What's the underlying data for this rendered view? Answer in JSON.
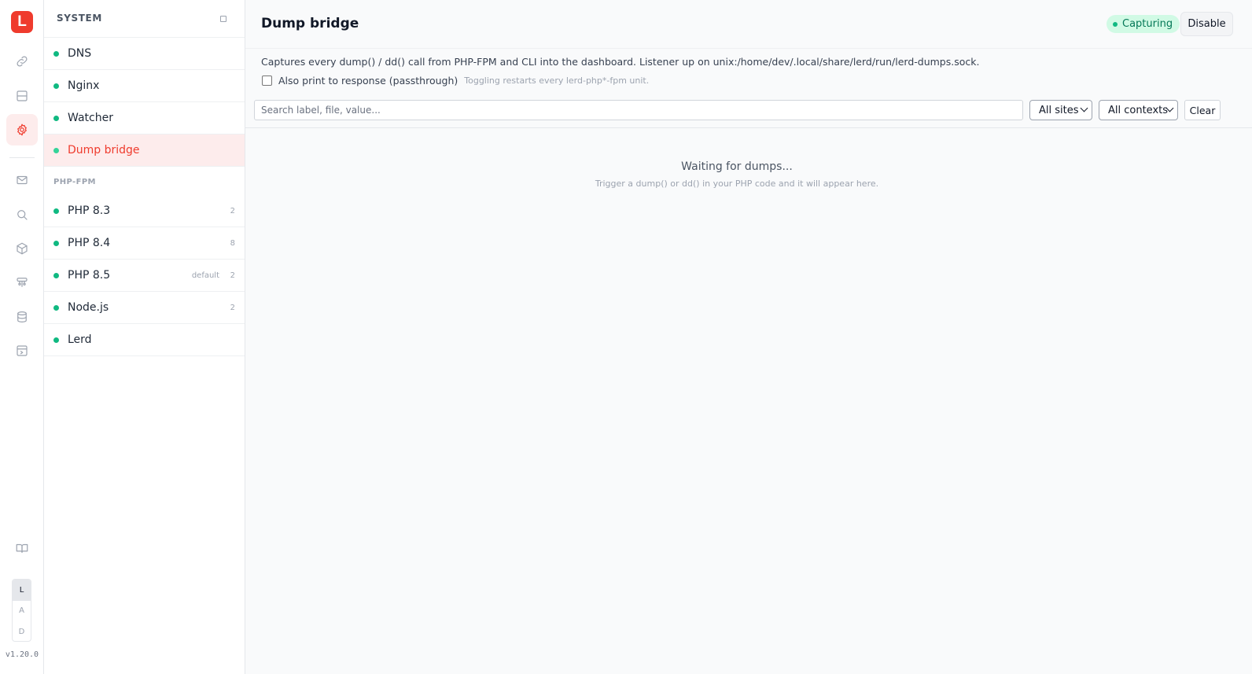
{
  "rail": {
    "logo_letter": "L",
    "items": [
      {
        "icon": "link-icon"
      },
      {
        "icon": "server-icon"
      },
      {
        "icon": "gear-icon",
        "active": true
      },
      {
        "icon": "mail-icon"
      },
      {
        "icon": "search-icon"
      },
      {
        "icon": "box-icon"
      },
      {
        "icon": "network-icon"
      },
      {
        "icon": "database-icon"
      },
      {
        "icon": "terminal-icon"
      },
      {
        "icon": "book-icon"
      }
    ],
    "theme_options": [
      "L",
      "A",
      "D"
    ],
    "theme_selected": "L",
    "version": "v1.20.0"
  },
  "sidebar": {
    "title": "SYSTEM",
    "system_items": [
      {
        "label": "DNS"
      },
      {
        "label": "Nginx"
      },
      {
        "label": "Watcher"
      },
      {
        "label": "Dump bridge",
        "active": true
      }
    ],
    "section_label": "PHP-FPM",
    "php_items": [
      {
        "label": "PHP 8.3",
        "count": "2"
      },
      {
        "label": "PHP 8.4",
        "count": "8"
      },
      {
        "label": "PHP 8.5",
        "tag": "default",
        "count": "2"
      },
      {
        "label": "Node.js",
        "count": "2"
      },
      {
        "label": "Lerd"
      }
    ]
  },
  "main": {
    "title": "Dump bridge",
    "status": "Capturing",
    "disable_label": "Disable",
    "description": "Captures every dump() / dd() call from PHP-FPM and CLI into the dashboard. Listener up on unix:/home/dev/.local/share/lerd/run/lerd-dumps.sock.",
    "passthrough_label": "Also print to response (passthrough)",
    "passthrough_hint": "Toggling restarts every lerd-php*-fpm unit.",
    "search_placeholder": "Search label, file, value...",
    "sites_filter": "All sites",
    "contexts_filter": "All contexts",
    "clear_label": "Clear",
    "empty_title": "Waiting for dumps...",
    "empty_subtitle": "Trigger a dump() or dd() in your PHP code and it will appear here."
  },
  "colors": {
    "accent": "#ef3b2d",
    "status_green": "#10b981",
    "active_bg": "#fdecec"
  }
}
